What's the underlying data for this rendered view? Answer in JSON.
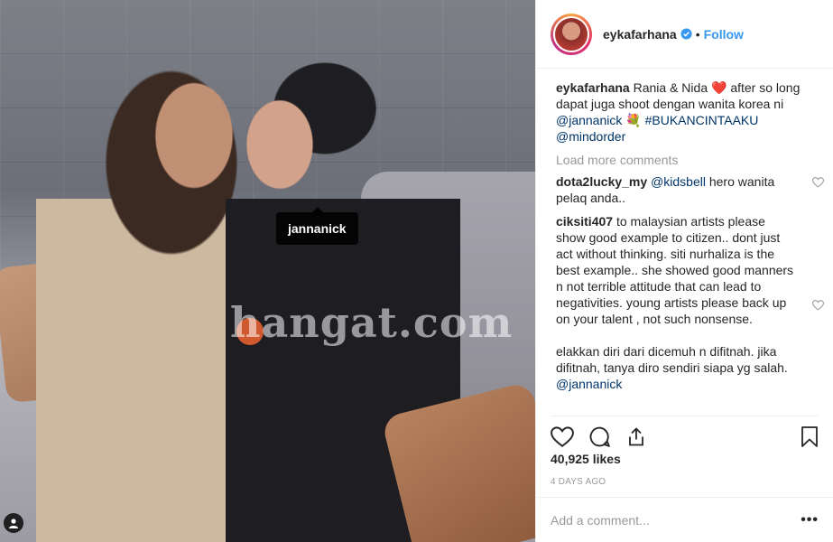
{
  "photo": {
    "watermark": "hangat.com",
    "tag_label": "jannanick"
  },
  "header": {
    "username": "eykafarhana",
    "separator": "•",
    "follow_label": "Follow"
  },
  "caption": {
    "username": "eykafarhana",
    "text_1": "Rania & Nida",
    "heart": "❤️",
    "text_2": "after so long dapat juga shoot dengan wanita korea ni",
    "mention_1": "@jannanick",
    "flower": "💐",
    "hashtag": "#BUKANCINTAAKU",
    "mention_2": "@mindorder"
  },
  "load_more_label": "Load more comments",
  "comments": [
    {
      "username": "dota2lucky_my",
      "mention": "@kidsbell",
      "text": "hero wanita pelaq anda.."
    },
    {
      "username": "ciksiti407",
      "text": "to malaysian artists please show good example to citizen.. dont just act without thinking. siti nurhaliza is the best example.. she showed good manners n not terrible attitude that can lead to negativities. young artists please back up on your talent , not such nonsense.",
      "text_2": "elakkan diri dari dicemuh n difitnah. jika difitnah, tanya diro sendiri siapa yg salah.",
      "mention": "@jannanick"
    }
  ],
  "likes": "40,925 likes",
  "time_ago": "4 DAYS AGO",
  "add_comment": {
    "placeholder": "Add a comment...",
    "more": "•••"
  },
  "colors": {
    "link": "#3897f0",
    "mention": "#003569",
    "muted": "#999999"
  }
}
